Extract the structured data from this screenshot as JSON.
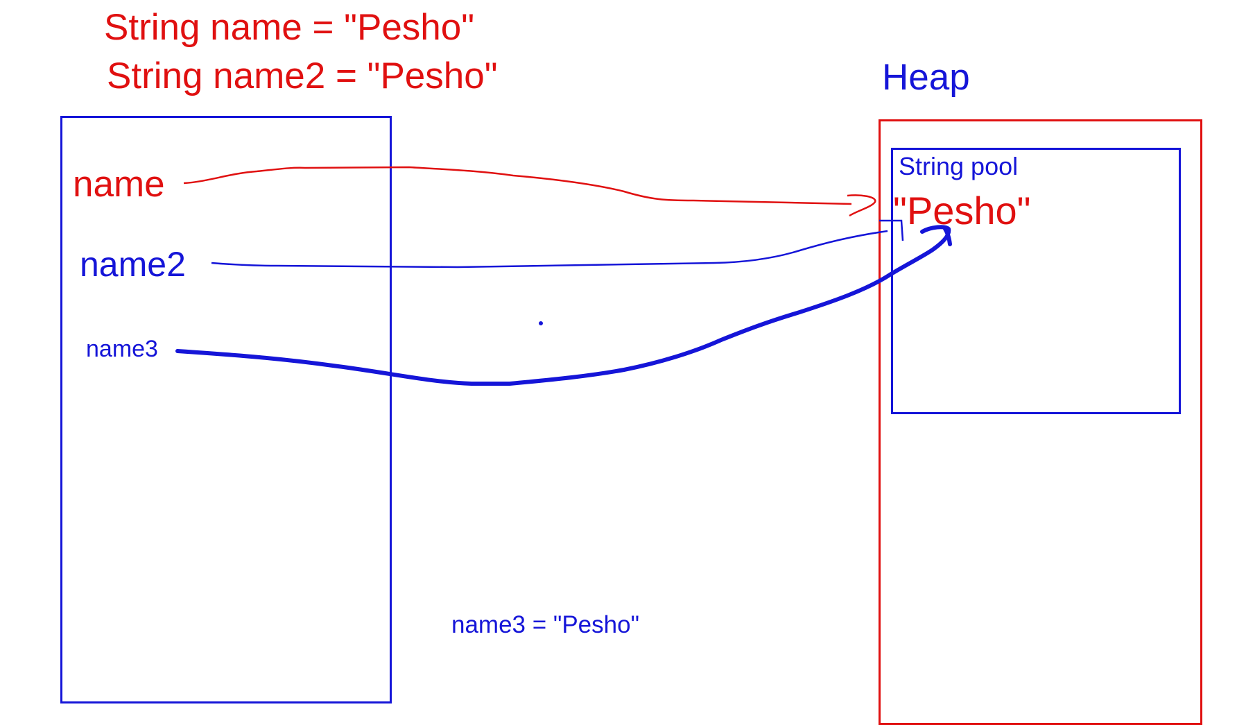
{
  "colors": {
    "red": "#e01010",
    "blue": "#1515d8"
  },
  "code": {
    "line1": "String name = \"Pesho\"",
    "line2": "String name2 = \"Pesho\""
  },
  "heap": {
    "title": "Heap",
    "pool": {
      "title": "String pool",
      "value": "\"Pesho\""
    }
  },
  "stack": {
    "variables": [
      "name",
      "name2",
      "name3"
    ]
  },
  "assignment": "name3 = \"Pesho\""
}
